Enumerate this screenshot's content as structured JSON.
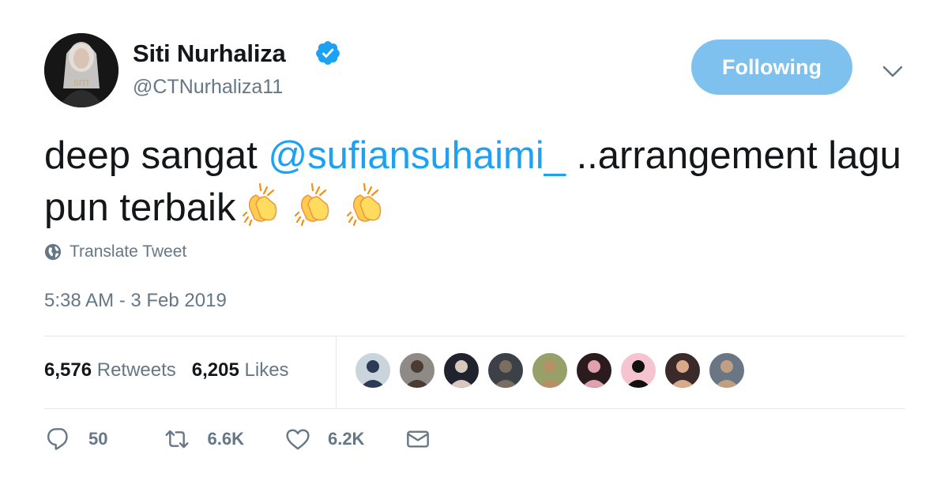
{
  "author": {
    "name": "Siti Nurhaliza",
    "handle": "@CTNurhaliza11",
    "verified": true,
    "avatar_icon": "profile-photo"
  },
  "follow_button": {
    "label": "Following"
  },
  "tweet": {
    "text_before": "deep sangat ",
    "mention": "@sufiansuhaimi_",
    "text_after": "  ..arrangement lagu pun terbaik",
    "emojis": [
      "clapping-hands",
      "clapping-hands",
      "clapping-hands"
    ],
    "translate_label": "Translate Tweet",
    "timestamp": "5:38 AM - 3 Feb 2019"
  },
  "stats": {
    "retweets_count": "6,576",
    "retweets_label": "Retweets",
    "likes_count": "6,205",
    "likes_label": "Likes"
  },
  "likers": [
    {
      "name": "liker-1",
      "bg": "#c9d4dc",
      "fg": "#2b3b55"
    },
    {
      "name": "liker-2",
      "bg": "#8f8a86",
      "fg": "#4a3b33"
    },
    {
      "name": "liker-3",
      "bg": "#20232e",
      "fg": "#d8c8bd"
    },
    {
      "name": "liker-4",
      "bg": "#3b4146",
      "fg": "#7b6d5f"
    },
    {
      "name": "liker-5",
      "bg": "#98a06a",
      "fg": "#b59065"
    },
    {
      "name": "liker-6",
      "bg": "#2b1b1e",
      "fg": "#e0a0b0"
    },
    {
      "name": "liker-7",
      "bg": "#f6c4d0",
      "fg": "#111111"
    },
    {
      "name": "liker-8",
      "bg": "#3a2a2a",
      "fg": "#d9a98a"
    },
    {
      "name": "liker-9",
      "bg": "#6b7684",
      "fg": "#c19f84"
    }
  ],
  "actions": {
    "reply_count": "50",
    "retweet_count": "6.6K",
    "like_count": "6.2K"
  },
  "colors": {
    "accent": "#1da1f2",
    "follow_bg": "#7fc1ee",
    "muted": "#657786"
  }
}
